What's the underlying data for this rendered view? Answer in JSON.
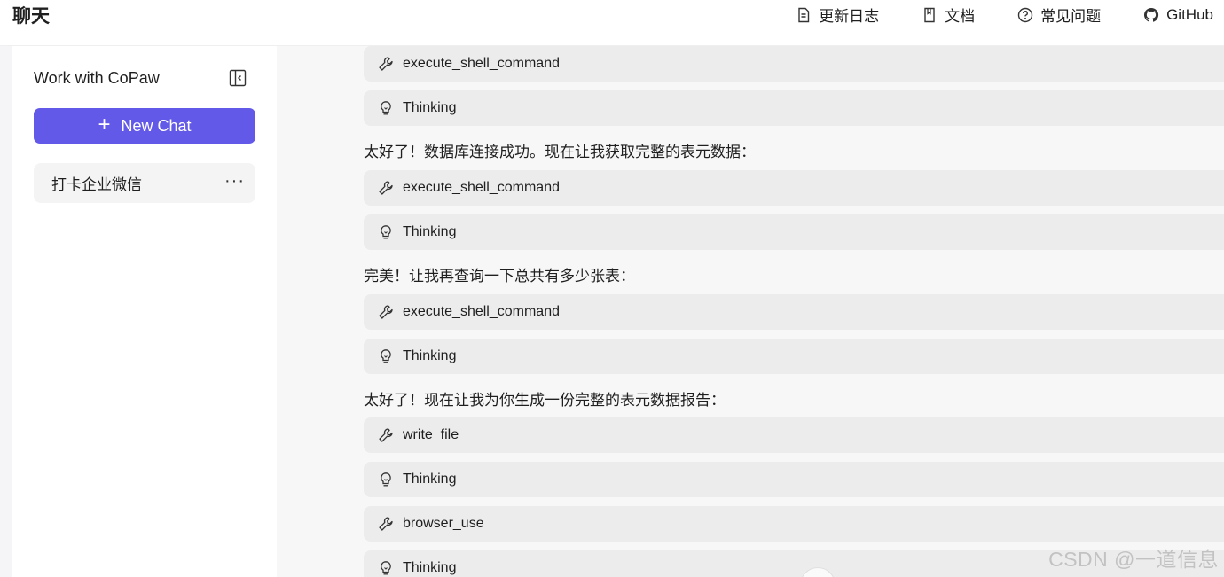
{
  "header": {
    "title": "聊天",
    "nav": [
      {
        "label": "更新日志",
        "icon": "file-text-icon"
      },
      {
        "label": "文档",
        "icon": "book-icon"
      },
      {
        "label": "常见问题",
        "icon": "question-circle-icon"
      },
      {
        "label": "GitHub",
        "icon": "github-icon"
      }
    ]
  },
  "sidebar": {
    "title": "Work with CoPaw",
    "collapse_icon": "sidebar-collapse-icon",
    "new_chat": {
      "plus": "+",
      "label": "New Chat"
    },
    "sessions": [
      {
        "label": "打卡企业微信",
        "more": "···"
      }
    ]
  },
  "chat": {
    "items": [
      {
        "kind": "tool",
        "label": "execute_shell_command",
        "icon": "wrench-icon"
      },
      {
        "kind": "tool",
        "label": "Thinking",
        "icon": "lightbulb-icon"
      },
      {
        "kind": "text",
        "label": "太好了！数据库连接成功。现在让我获取完整的表元数据："
      },
      {
        "kind": "tool",
        "label": "execute_shell_command",
        "icon": "wrench-icon"
      },
      {
        "kind": "tool",
        "label": "Thinking",
        "icon": "lightbulb-icon"
      },
      {
        "kind": "text",
        "label": "完美！让我再查询一下总共有多少张表："
      },
      {
        "kind": "tool",
        "label": "execute_shell_command",
        "icon": "wrench-icon"
      },
      {
        "kind": "tool",
        "label": "Thinking",
        "icon": "lightbulb-icon"
      },
      {
        "kind": "text",
        "label": "太好了！现在让我为你生成一份完整的表元数据报告："
      },
      {
        "kind": "tool",
        "label": "write_file",
        "icon": "wrench-icon"
      },
      {
        "kind": "tool",
        "label": "Thinking",
        "icon": "lightbulb-icon"
      },
      {
        "kind": "tool",
        "label": "browser_use",
        "icon": "wrench-icon"
      },
      {
        "kind": "tool",
        "label": "Thinking",
        "icon": "lightbulb-icon"
      }
    ]
  },
  "watermark": "CSDN @一道信息",
  "colors": {
    "accent": "#6359e9",
    "tool_bg": "#ececec",
    "main_bg": "#f7f7f7"
  }
}
